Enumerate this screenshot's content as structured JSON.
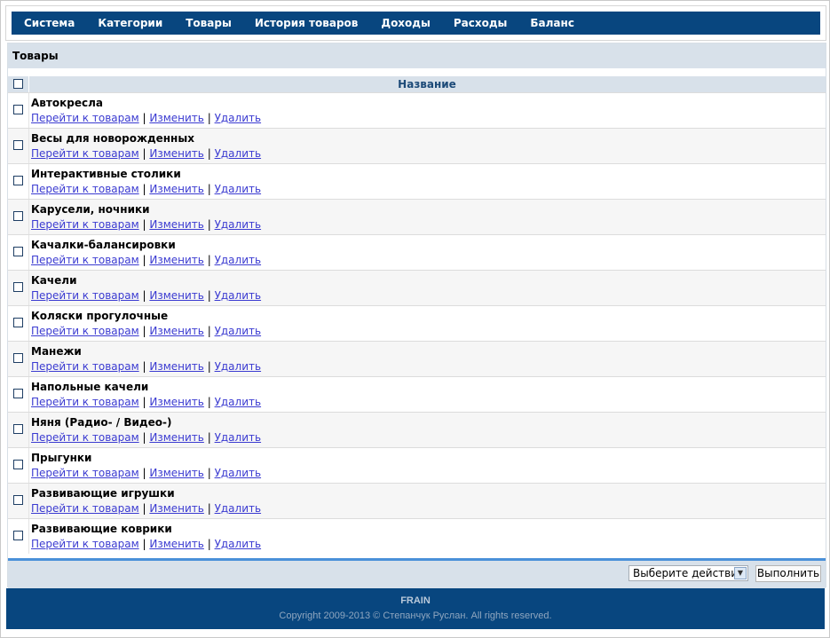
{
  "nav": {
    "items": [
      "Система",
      "Категории",
      "Товары",
      "История товаров",
      "Доходы",
      "Расходы",
      "Баланс"
    ]
  },
  "panel": {
    "title": "Товары",
    "column_name": "Название"
  },
  "rows": [
    {
      "name": "Автокресла"
    },
    {
      "name": "Весы для новорожденных"
    },
    {
      "name": "Интерактивные столики"
    },
    {
      "name": "Карусели, ночники"
    },
    {
      "name": "Качалки-балансировки"
    },
    {
      "name": "Качели"
    },
    {
      "name": "Коляски прогулочные"
    },
    {
      "name": "Манежи"
    },
    {
      "name": "Напольные качели"
    },
    {
      "name": "Няня (Радио- / Видео-)"
    },
    {
      "name": "Прыгунки"
    },
    {
      "name": "Развивающие игрушки"
    },
    {
      "name": "Развивающие коврики"
    }
  ],
  "row_links": {
    "goto": "Перейти к товарам",
    "edit": "Изменить",
    "delete": "Удалить",
    "separator": "|"
  },
  "actions": {
    "select_value": "Выберите действие",
    "submit_label": "Выполнить"
  },
  "footer": {
    "brand": "FRAIN",
    "copyright": "Copyright 2009-2013 © Степанчук Руслан. All rights reserved."
  },
  "colors": {
    "nav_bg": "#08467f",
    "header_bg": "#d8e1ea",
    "link": "#3b3bd1",
    "accent_line": "#4a90d9"
  }
}
